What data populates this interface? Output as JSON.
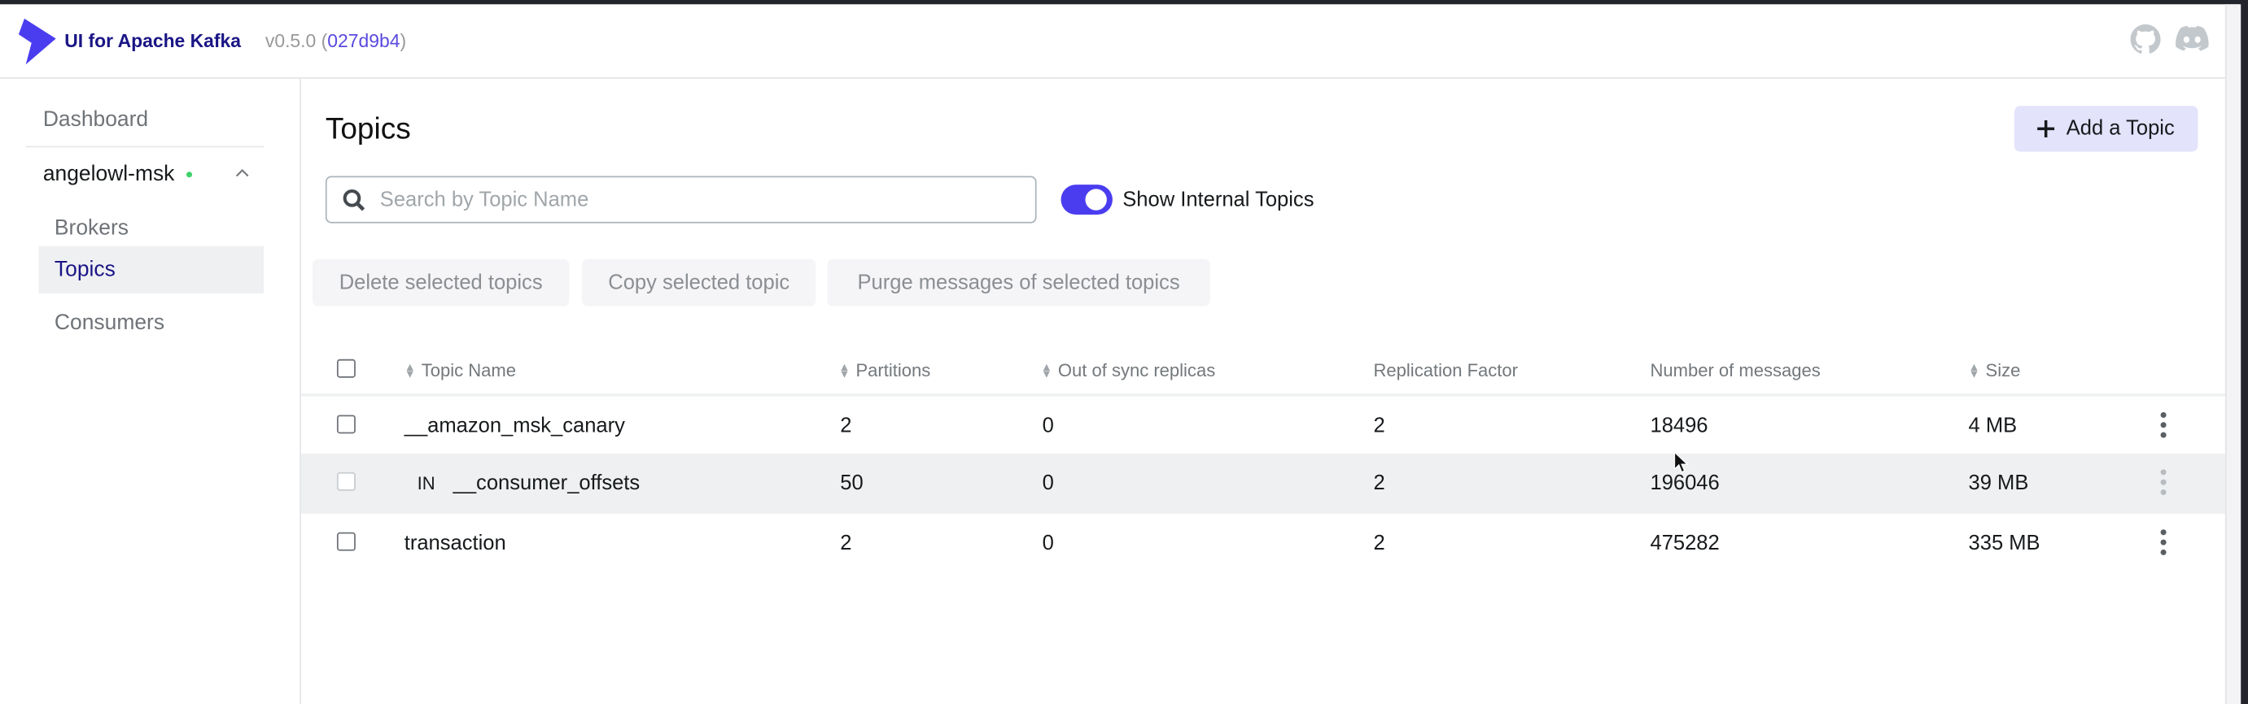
{
  "header": {
    "brand": "UI for Apache Kafka",
    "version": "v0.5.0",
    "commit": "027d9b4",
    "icons": [
      "github-icon",
      "discord-icon"
    ]
  },
  "sidebar": {
    "dashboard": "Dashboard",
    "cluster": {
      "name": "angelowl-msk",
      "status_color": "#3fd26b"
    },
    "items": [
      {
        "label": "Brokers"
      },
      {
        "label": "Topics",
        "active": true
      },
      {
        "label": "Consumers"
      }
    ]
  },
  "main": {
    "title": "Topics",
    "add_button": "Add a Topic",
    "search": {
      "placeholder": "Search by Topic Name",
      "value": ""
    },
    "toggle": {
      "label": "Show Internal Topics",
      "on": true
    },
    "actions": [
      "Delete selected topics",
      "Copy selected topic",
      "Purge messages of selected topics"
    ],
    "table": {
      "columns": [
        "Topic Name",
        "Partitions",
        "Out of sync replicas",
        "Replication Factor",
        "Number of messages",
        "Size"
      ],
      "rows": [
        {
          "name": "__amazon_msk_canary",
          "badge": "",
          "partitions": "2",
          "out_of_sync": "0",
          "replication": "2",
          "messages": "18496",
          "size": "4 MB"
        },
        {
          "name": "__consumer_offsets",
          "badge": "IN",
          "partitions": "50",
          "out_of_sync": "0",
          "replication": "2",
          "messages": "196046",
          "size": "39 MB"
        },
        {
          "name": "transaction",
          "badge": "",
          "partitions": "2",
          "out_of_sync": "0",
          "replication": "2",
          "messages": "475282",
          "size": "335 MB"
        }
      ]
    }
  },
  "colors": {
    "accent": "#4a3df0",
    "brand_text": "#1a1585",
    "add_button_bg": "#e3e3fc"
  }
}
